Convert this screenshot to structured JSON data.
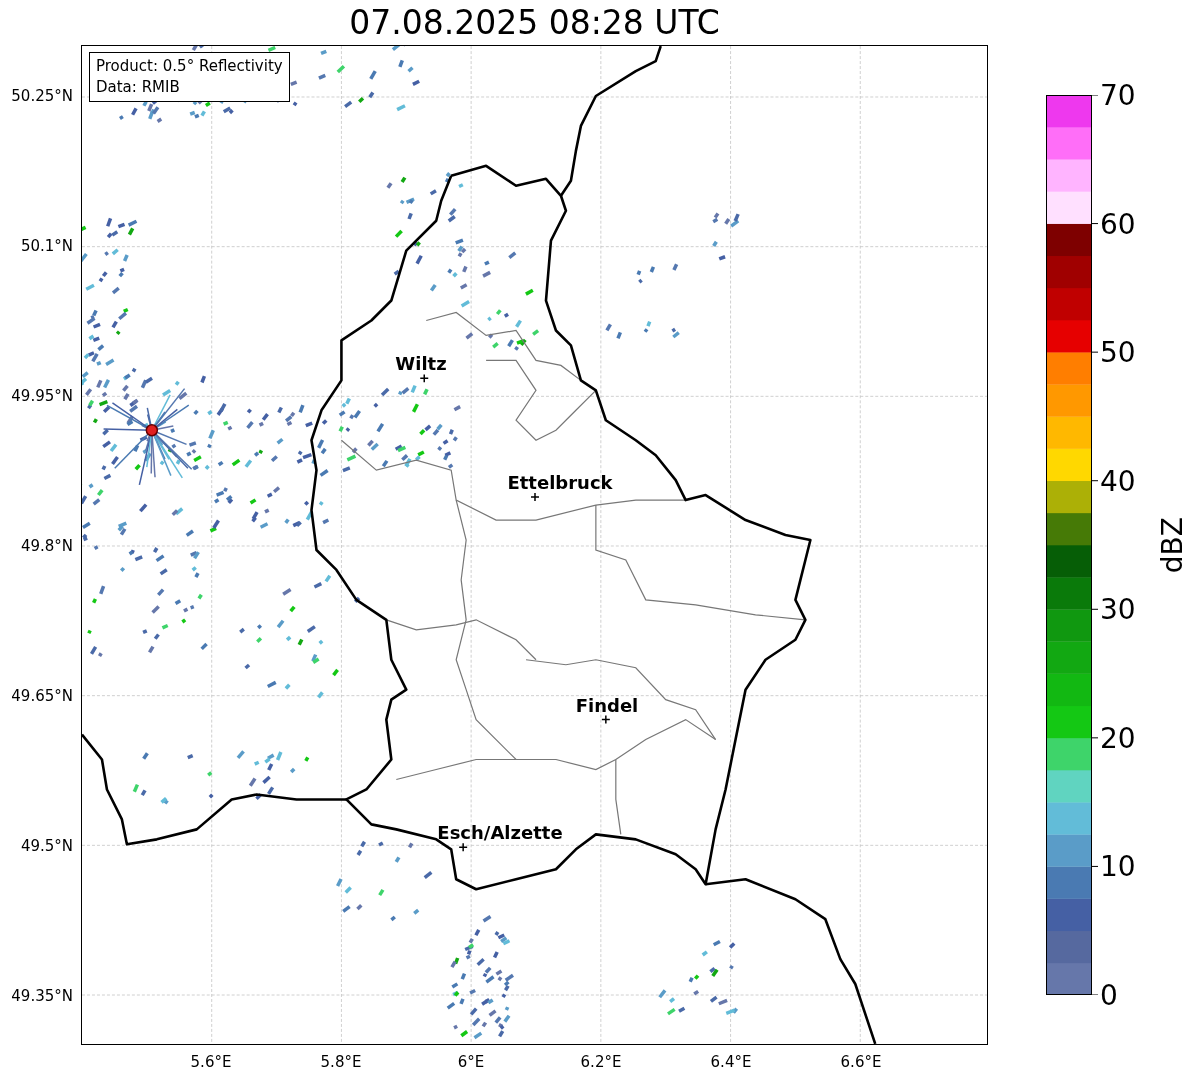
{
  "title": "07.08.2025 08:28 UTC",
  "info_box": {
    "lines": [
      "Product: 0.5° Reflectivity",
      "Data: RMIB"
    ]
  },
  "cities": [
    {
      "name": "Wiltz"
    },
    {
      "name": "Ettelbruck"
    },
    {
      "name": "Findel"
    },
    {
      "name": "Esch/Alzette"
    }
  ],
  "x_ticks": [
    "5.6°E",
    "5.8°E",
    "6°E",
    "6.2°E",
    "6.4°E",
    "6.6°E"
  ],
  "y_ticks": [
    "50.25°N",
    "50.1°N",
    "49.95°N",
    "49.8°N",
    "49.65°N",
    "49.5°N",
    "49.35°N"
  ],
  "colorbar": {
    "ticks": [
      "70",
      "60",
      "50",
      "40",
      "30",
      "20",
      "10",
      "0"
    ],
    "label": "dBZ"
  }
}
